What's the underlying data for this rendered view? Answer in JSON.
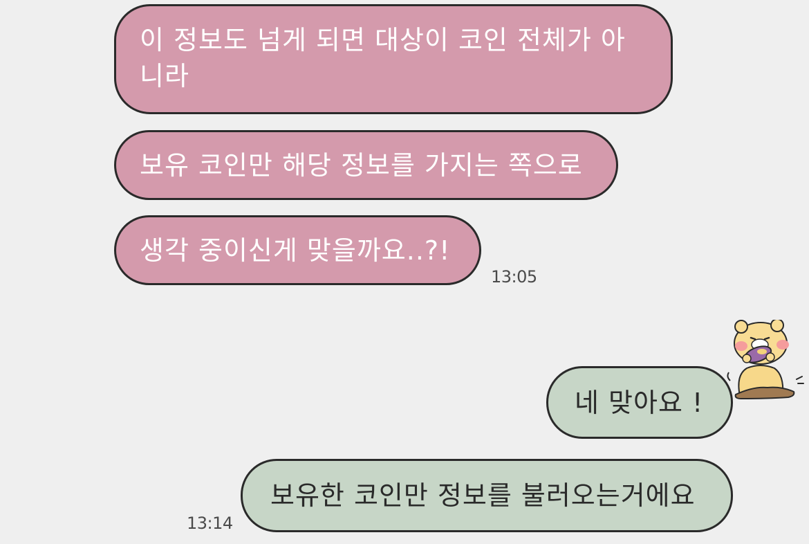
{
  "incoming": [
    {
      "text": "이  정보도 넘게 되면 대상이 코인 전체가 아니라"
    },
    {
      "text": "보유 코인만 해당 정보를 가지는 쪽으로"
    },
    {
      "text": "생각 중이신게 맞을까요..?!"
    }
  ],
  "incoming_time": "13:05",
  "outgoing": [
    {
      "text": "네 맞아요 !"
    },
    {
      "text": "보유한 코인만 정보를 불러오는거에요"
    }
  ],
  "outgoing_time": "13:14",
  "sticker": {
    "icon": "bear-eating-sweet-potato-sticker"
  },
  "colors": {
    "incoming_bubble": "#d49aac",
    "outgoing_bubble": "#c7d6c7",
    "background": "#efefef",
    "outline": "#2a2a2a"
  }
}
